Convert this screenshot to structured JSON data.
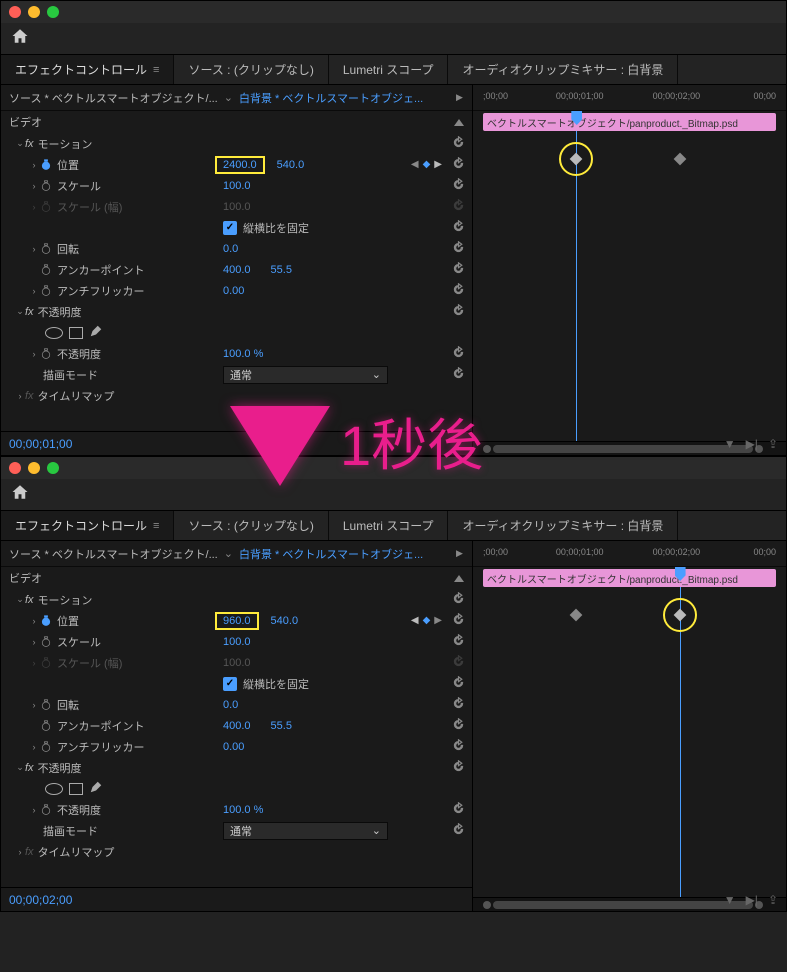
{
  "overlay_text": "1秒後",
  "tabs": {
    "effect_controls": "エフェクトコントロール",
    "source": "ソース : (クリップなし)",
    "lumetri": "Lumetri スコープ",
    "audio_mixer": "オーディオクリップミキサー : 白背景"
  },
  "source_row": {
    "source": "ソース * ベクトルスマートオブジェクト/...",
    "sequence": "白背景 * ベクトルスマートオブジェ..."
  },
  "sections": {
    "video": "ビデオ",
    "motion": "モーション",
    "opacity": "不透明度",
    "timeremap": "タイムリマップ"
  },
  "props": {
    "position": "位置",
    "scale": "スケール",
    "scale_width": "スケール (幅)",
    "lock_aspect": "縦横比を固定",
    "rotation": "回転",
    "anchor": "アンカーポイント",
    "antiflicker": "アンチフリッカー",
    "opacity_val": "不透明度",
    "blend_mode": "描画モード"
  },
  "panel1": {
    "position_x": "2400.0",
    "position_y": "540.0",
    "scale": "100.0",
    "scale_w": "100.0",
    "rotation": "0.0",
    "anchor_x": "400.0",
    "anchor_y": "55.5",
    "antiflicker": "0.00",
    "opacity": "100.0 %",
    "blend": "通常",
    "timecode": "00;00;01;00"
  },
  "panel2": {
    "position_x": "960.0",
    "position_y": "540.0",
    "scale": "100.0",
    "scale_w": "100.0",
    "rotation": "0.0",
    "anchor_x": "400.0",
    "anchor_y": "55.5",
    "antiflicker": "0.00",
    "opacity": "100.0 %",
    "blend": "通常",
    "timecode": "00;00;02;00"
  },
  "timeline": {
    "ticks": [
      ";00;00",
      "00;00;01;00",
      "00;00;02;00",
      "00;00"
    ],
    "clip_name": "ベクトルスマートオブジェクト/panproduct._Bitmap.psd"
  }
}
